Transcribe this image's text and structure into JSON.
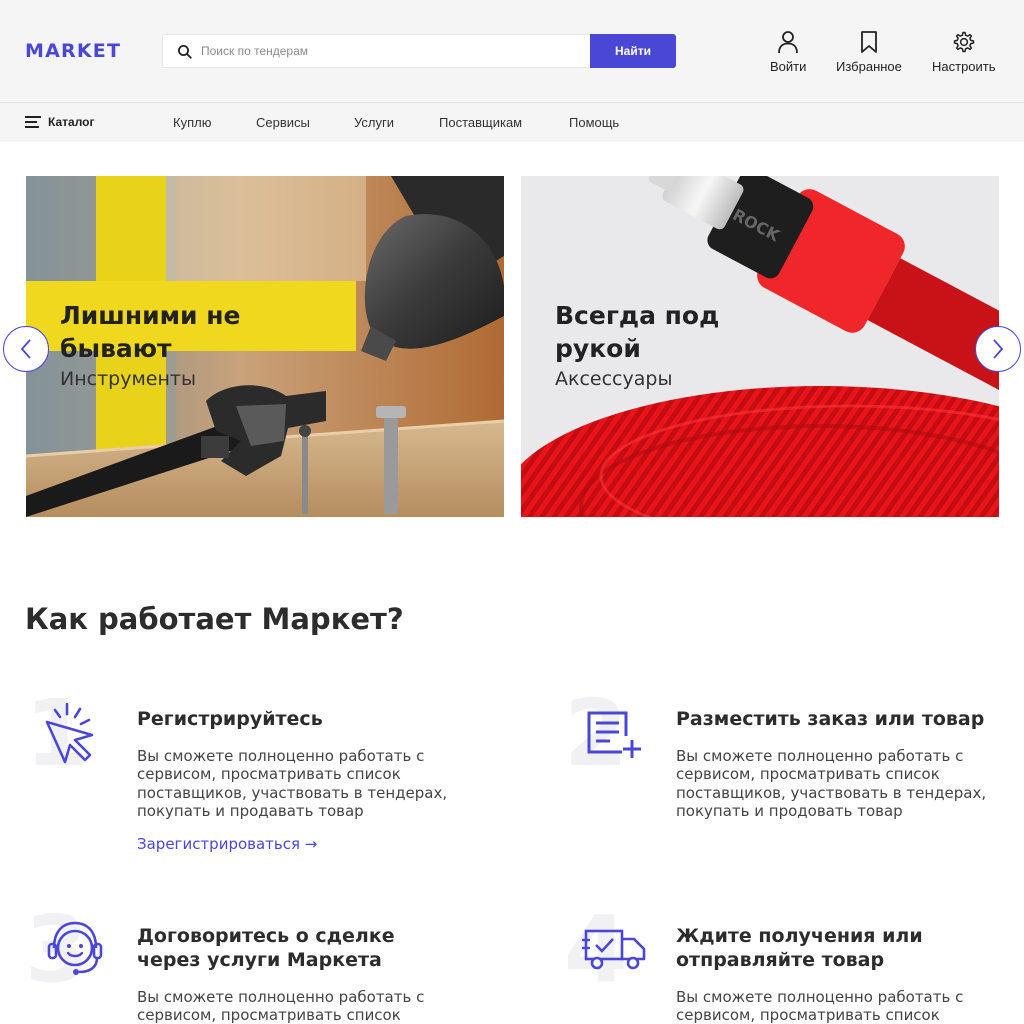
{
  "header": {
    "logo": "MARKET",
    "search_placeholder": "Поиск по тендерам",
    "search_button": "Найти",
    "login": "Войти",
    "favorites": "Избранное",
    "settings": "Настроить"
  },
  "nav": {
    "catalog": "Каталог",
    "links": [
      "Куплю",
      "Сервисы",
      "Услуги",
      "Поставщикам",
      "Помощь"
    ]
  },
  "banners": [
    {
      "title": "Лишними не бывают",
      "subtitle": "Инструменты",
      "brand_mark": ""
    },
    {
      "title": "Всегда под рукой",
      "subtitle": "Аксессуары",
      "brand_mark": "ROCK"
    }
  ],
  "how": {
    "title": "Как работает Маркет?",
    "steps": [
      {
        "num": "1",
        "icon": "click-cursor-icon",
        "title": "Регистрируйтесь",
        "text": "Вы сможете полноценно работать с сервисом, просматривать список поставщиков, участвовать в тендерах, покупать и продавать товар",
        "link": "Зарегистрироваться →"
      },
      {
        "num": "2",
        "icon": "add-order-icon",
        "title": "Разместить заказ или товар",
        "text": "Вы сможете полноценно работать с сервисом, просматривать список поставщиков, участвовать в тендерах, покупать и продовать товар"
      },
      {
        "num": "3",
        "icon": "support-agent-icon",
        "title": "Договоритесь о сделке через услуги Маркета",
        "text": "Вы сможете полноценно работать с сервисом, просматривать список"
      },
      {
        "num": "4",
        "icon": "delivery-truck-icon",
        "title": "Ждите получения или отправляйте товар",
        "text": "Вы сможете полноценно работать с сервисом, просматривать список"
      }
    ]
  },
  "colors": {
    "accent": "#4b47d6",
    "header_bg": "#f5f5f5"
  }
}
